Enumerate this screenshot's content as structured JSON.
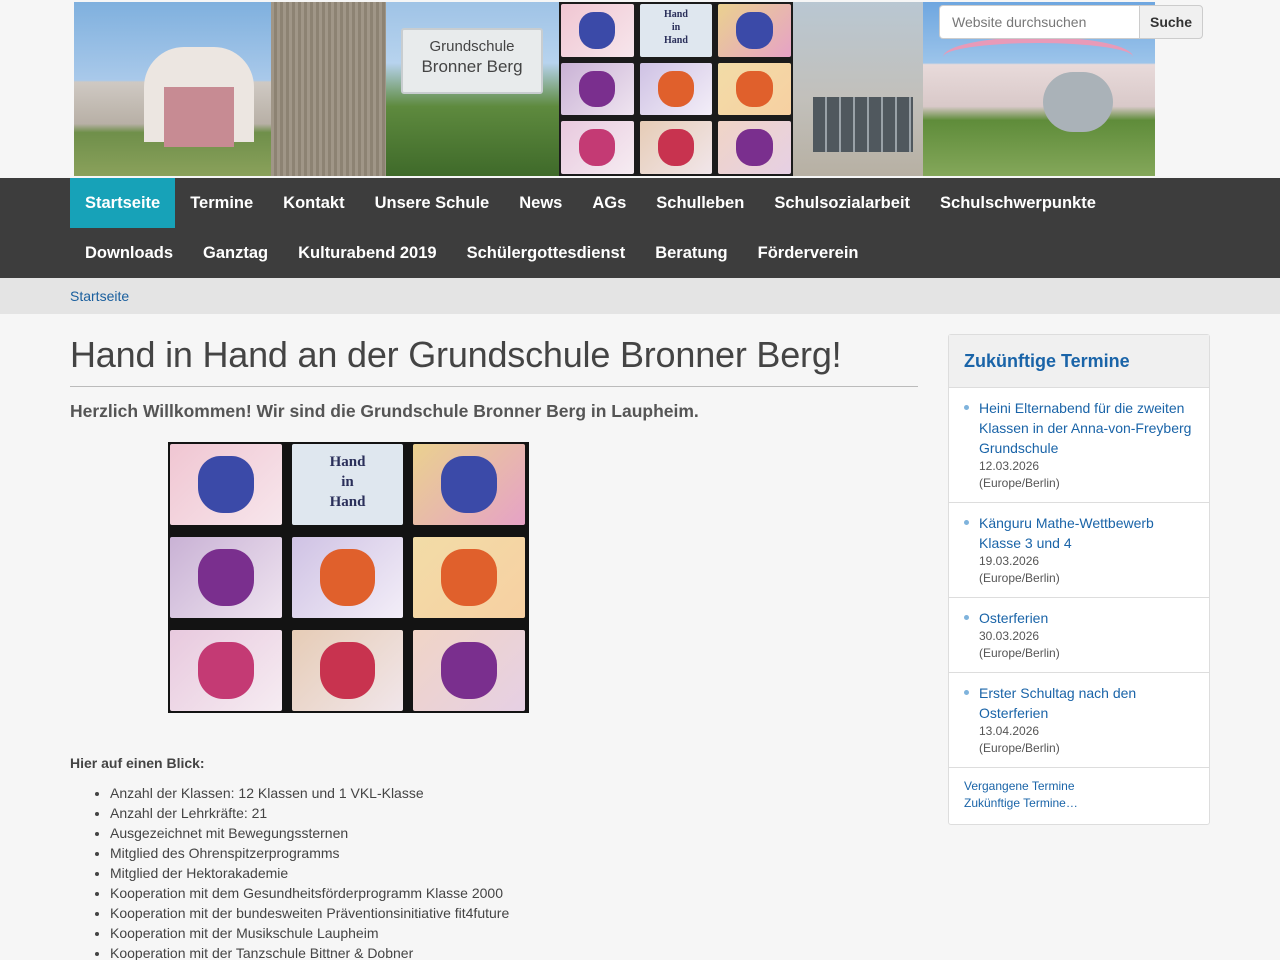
{
  "header": {
    "sign_line1": "Grundschule",
    "sign_line2": "Bronner Berg",
    "banner_artwork_words": [
      "Hand",
      "in",
      "Hand"
    ],
    "search": {
      "placeholder": "Website durchsuchen",
      "button_label": "Suche"
    }
  },
  "nav": {
    "items": [
      {
        "label": "Startseite",
        "active": true
      },
      {
        "label": "Termine"
      },
      {
        "label": "Kontakt"
      },
      {
        "label": "Unsere Schule"
      },
      {
        "label": "News"
      },
      {
        "label": "AGs"
      },
      {
        "label": "Schulleben"
      },
      {
        "label": "Schulsozialarbeit"
      },
      {
        "label": "Schulschwerpunkte"
      },
      {
        "label": "Downloads"
      },
      {
        "label": "Ganztag"
      },
      {
        "label": "Kulturabend 2019"
      },
      {
        "label": "Schülergottesdienst"
      },
      {
        "label": "Beratung"
      },
      {
        "label": "Förderverein"
      }
    ],
    "active_color": "#17a2b8"
  },
  "breadcrumb": {
    "current": "Startseite"
  },
  "main": {
    "title": "Hand in Hand an der Grundschule Bronner Berg!",
    "subtitle": "Herzlich Willkommen! Wir sind die Grundschule Bronner Berg in Laupheim.",
    "image_words": [
      "Hand",
      "in",
      "Hand"
    ],
    "glance_heading": "Hier auf einen Blick:",
    "facts": [
      "Anzahl der Klassen: 12 Klassen und 1 VKL-Klasse",
      "Anzahl der Lehrkräfte: 21",
      "Ausgezeichnet mit Bewegungssternen",
      "Mitglied des Ohrenspitzerprogramms",
      "Mitglied der Hektorakademie",
      "Kooperation mit dem Gesundheitsförderprogramm Klasse 2000",
      "Kooperation mit der bundesweiten Präventionsinitiative fit4future",
      "Kooperation mit der Musikschule Laupheim",
      "Kooperation mit der Tanzschule Bittner & Dobner"
    ]
  },
  "sidebar": {
    "heading": "Zukünftige Termine",
    "events": [
      {
        "title": "Heini Elternabend für die zweiten Klassen in der Anna-von-Freyberg Grundschule",
        "date": "12.03.2026",
        "tz": "(Europe/Berlin)"
      },
      {
        "title": "Känguru Mathe-Wettbewerb Klasse 3 und 4",
        "date": "19.03.2026",
        "tz": "(Europe/Berlin)"
      },
      {
        "title": "Osterferien",
        "date": "30.03.2026",
        "tz": "(Europe/Berlin)"
      },
      {
        "title": "Erster Schultag nach den Osterferien",
        "date": "13.04.2026",
        "tz": "(Europe/Berlin)"
      }
    ],
    "past_link": "Vergangene Termine",
    "future_link": "Zukünftige Termine…"
  },
  "colors": {
    "nav_bg": "#3d3d3d",
    "link": "#1a64a8",
    "accent": "#17a2b8"
  }
}
